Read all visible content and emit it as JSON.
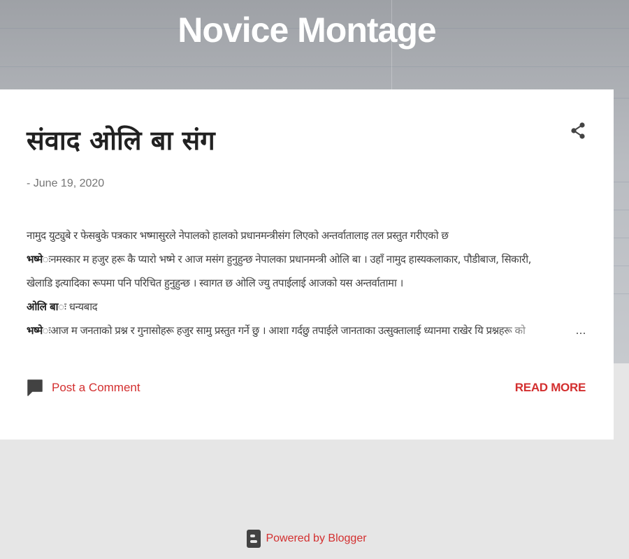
{
  "blog": {
    "title": "Novice Montage"
  },
  "post": {
    "title": "संवाद ओलि बा संग",
    "date": "- June 19, 2020",
    "lines": [
      {
        "bold": "",
        "text": "नामुद युट्युबे र फेसबुके पत्रकार भष्मासुरले नेपालको हालको प्रधानमन्त्रीसंग लिएको अन्तर्वातालाइ तल प्रस्तुत गरीएको छ"
      },
      {
        "bold": "भष्मे",
        "text": "ःनमस्कार म हजुर हरू कै प्यारो भष्मे र आज मसंग हुनुहुन्छ नेपालका प्रधानमन्त्री ओलि बा । उहाँ नामुद हास्यकलाकार, पौडीबाज, सिकारी,"
      },
      {
        "bold": "",
        "text": "खेलाडि इत्यादिका रूपमा पनि परिचित हुनुहुन्छ । स्वागत छ ओलि ज्यु तपाईलाई आजको यस अन्तर्वातामा ।"
      },
      {
        "bold": "ओलि बा",
        "text": "ः  धन्यबाद"
      },
      {
        "bold": "भष्मे",
        "text": "ःआज म जनताको प्रश्न र गुनासोहरू हजुर सामु प्रस्तुत गर्ने छु । आशा गर्दछु तपाईले जानताका उत्सुक्तालाई ध्यानमा राखेर यि प्रश्नहरू को"
      }
    ],
    "ellipsis": "…",
    "comment_label": "Post a Comment",
    "read_more_label": "READ MORE"
  },
  "footer": {
    "powered_label": "Powered by Blogger"
  },
  "icons": {
    "share": "share-icon",
    "comment": "comment-icon",
    "blogger": "blogger-icon"
  },
  "colors": {
    "accent": "#d32f2f",
    "text": "#212121",
    "muted": "#757575",
    "page_bg": "#e6e6e6"
  }
}
